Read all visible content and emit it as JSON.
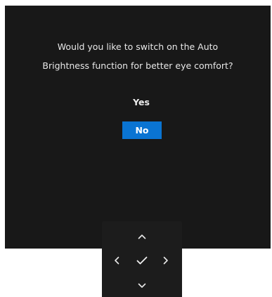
{
  "dialog": {
    "prompt_line1": "Would you like to switch on the Auto",
    "prompt_line2": "Brightness function for better eye comfort?",
    "options": [
      {
        "label": "Yes",
        "selected": false
      },
      {
        "label": "No",
        "selected": true
      }
    ]
  },
  "joystick": {
    "buttons": [
      "chevron-up-icon",
      "chevron-left-icon",
      "checkmark-icon",
      "chevron-right-icon",
      "chevron-down-icon"
    ]
  },
  "colors": {
    "panel_background": "#181818",
    "selected_option": "#0a74d2",
    "text": "#e8e8e8"
  }
}
